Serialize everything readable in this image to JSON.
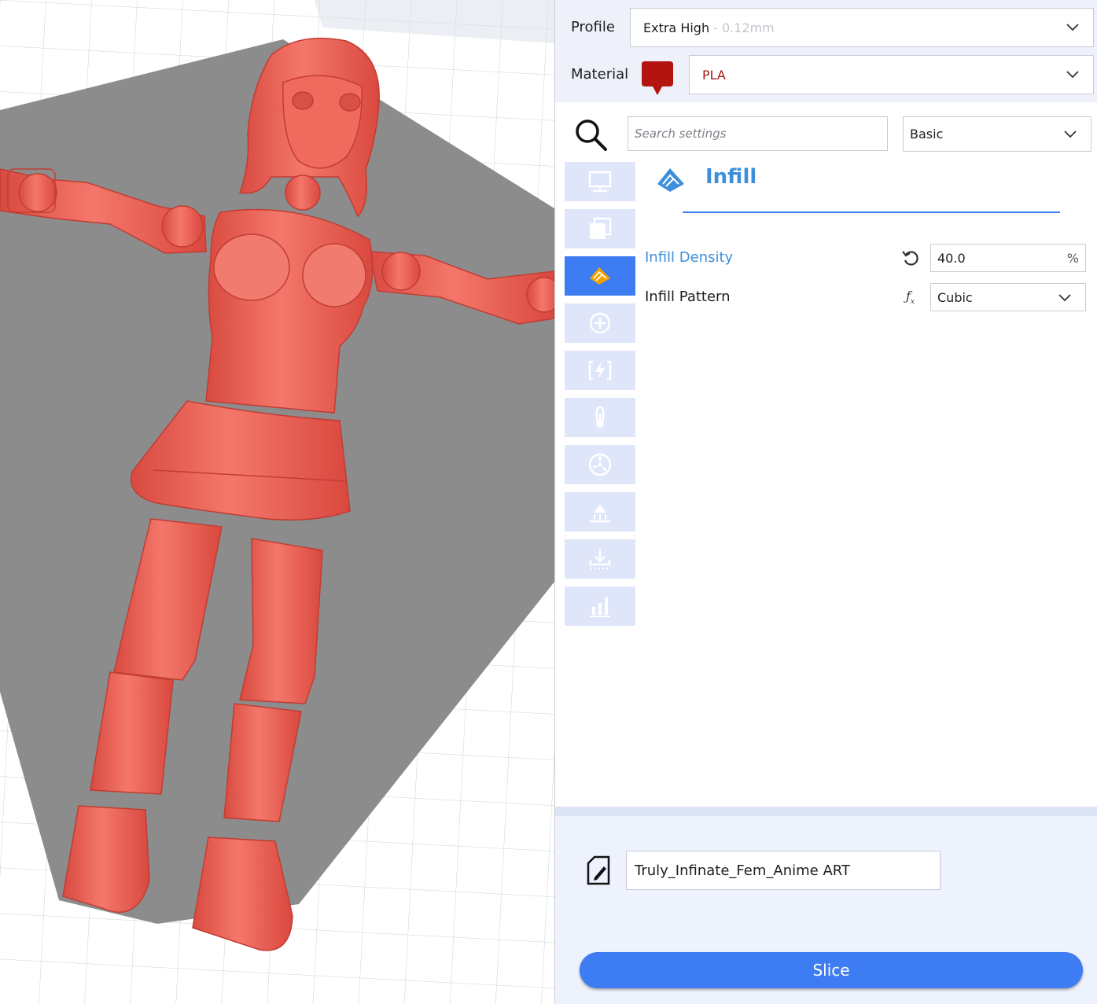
{
  "settings_header": {
    "profile_label": "Profile",
    "profile_value": "Extra High",
    "profile_layer_height": "- 0.12mm",
    "material_label": "Material",
    "material_value": "PLA",
    "material_color": "#b41410"
  },
  "search": {
    "placeholder": "Search settings",
    "visibility_value": "Basic"
  },
  "categories": [
    {
      "name": "quality",
      "icon": "monitor-icon",
      "active": false
    },
    {
      "name": "walls",
      "icon": "stacked-squares-icon",
      "active": false
    },
    {
      "name": "infill",
      "icon": "infill-icon",
      "active": true
    },
    {
      "name": "material",
      "icon": "plus-circle-icon",
      "active": false
    },
    {
      "name": "speed",
      "icon": "lightning-icon",
      "active": false
    },
    {
      "name": "temperature",
      "icon": "thermometer-icon",
      "active": false
    },
    {
      "name": "cooling",
      "icon": "fan-icon",
      "active": false
    },
    {
      "name": "support",
      "icon": "support-icon",
      "active": false
    },
    {
      "name": "adhesion",
      "icon": "download-tray-icon",
      "active": false
    },
    {
      "name": "experimental",
      "icon": "bar-chart-icon",
      "active": false
    }
  ],
  "section": {
    "title": "Infill",
    "settings": [
      {
        "label": "Infill Density",
        "value": "40.0",
        "unit": "%",
        "control": "text",
        "indicator": "reset-icon"
      },
      {
        "label": "Infill Pattern",
        "value": "Cubic",
        "control": "dropdown",
        "indicator": "function-icon"
      }
    ]
  },
  "output": {
    "job_name": "Truly_Infinate_Fem_Anime ART",
    "slice_label": "Slice"
  },
  "colors": {
    "accent": "#3d7cf2",
    "model": "#ef6155",
    "build_plate_shadow": "#8c8c8c"
  }
}
